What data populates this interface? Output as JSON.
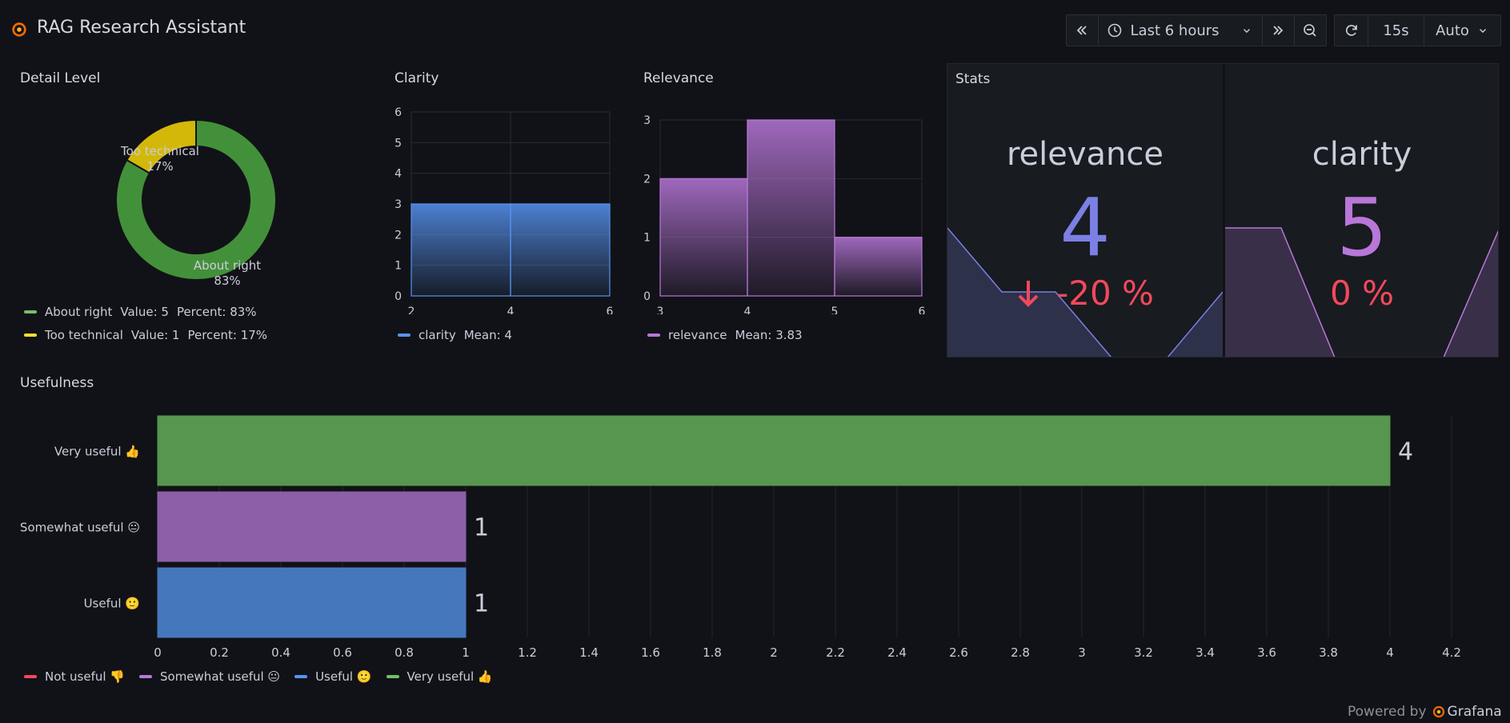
{
  "app": {
    "title": "RAG Research Assistant"
  },
  "toolbar": {
    "back_icon": "chevrons-left-icon",
    "time_range": "Last 6 hours",
    "forward_icon": "chevrons-right-icon",
    "zoom_icon": "zoom-out-icon",
    "refresh_icon": "refresh-icon",
    "refresh_interval": "15s",
    "auto_label": "Auto"
  },
  "panels": {
    "detail_level": {
      "title": "Detail Level",
      "legend": [
        {
          "name": "About right",
          "value_text": "Value: 5",
          "percent_text": "Percent: 83%",
          "color": "#73bf69"
        },
        {
          "name": "Too technical",
          "value_text": "Value: 1",
          "percent_text": "Percent: 17%",
          "color": "#fade2a"
        }
      ],
      "slice_labels": [
        {
          "name": "About right",
          "pct": "83%"
        },
        {
          "name": "Too technical",
          "pct": "17%"
        }
      ]
    },
    "clarity": {
      "title": "Clarity",
      "legend": {
        "name": "clarity",
        "mean": "Mean: 4",
        "color": "#5794f2"
      }
    },
    "relevance": {
      "title": "Relevance",
      "legend": {
        "name": "relevance",
        "mean": "Mean: 3.83",
        "color": "#b877d9"
      }
    },
    "stats": {
      "title": "Stats",
      "items": [
        {
          "label": "relevance",
          "value": "4",
          "change": "-20 %",
          "color": "#7c7fe4",
          "change_color": "#f2495c"
        },
        {
          "label": "clarity",
          "value": "5",
          "change": "0 %",
          "color": "#b877d9",
          "change_color": "#f2495c"
        }
      ]
    },
    "usefulness": {
      "title": "Usefulness",
      "legend": [
        {
          "name": "Not useful 👎",
          "color": "#f2495c"
        },
        {
          "name": "Somewhat useful 😐",
          "color": "#b877d9"
        },
        {
          "name": "Useful 🙂",
          "color": "#5794f2"
        },
        {
          "name": "Very useful 👍",
          "color": "#73bf69"
        }
      ]
    }
  },
  "chart_data": [
    {
      "type": "pie",
      "title": "Detail Level",
      "categories": [
        "About right",
        "Too technical"
      ],
      "values": [
        5,
        1
      ],
      "colors": [
        "#43903a",
        "#d3b80a"
      ]
    },
    {
      "type": "bar",
      "title": "Clarity",
      "bins": [
        [
          2,
          4
        ],
        [
          4,
          6
        ]
      ],
      "values": [
        3,
        3
      ],
      "xticks": [
        "2",
        "4",
        "6"
      ],
      "yticks": [
        "0",
        "1",
        "2",
        "3",
        "4",
        "5",
        "6"
      ],
      "ylim": [
        0,
        6
      ],
      "xlim": [
        2,
        6
      ]
    },
    {
      "type": "bar",
      "title": "Relevance",
      "bins": [
        [
          3,
          4
        ],
        [
          4,
          5
        ],
        [
          5,
          6
        ]
      ],
      "values": [
        2,
        3,
        1
      ],
      "xticks": [
        "3",
        "4",
        "5",
        "6"
      ],
      "yticks": [
        "0",
        "1",
        "2",
        "3"
      ],
      "ylim": [
        0,
        3
      ],
      "xlim": [
        3,
        6
      ]
    },
    {
      "type": "bar",
      "title": "Usefulness",
      "orientation": "horizontal",
      "categories": [
        "Very useful 👍",
        "Somewhat useful 😐",
        "Useful 🙂"
      ],
      "values": [
        4,
        1,
        1
      ],
      "value_labels": [
        "4",
        "1",
        "1"
      ],
      "colors": [
        "#56964f",
        "#8c5fa8",
        "#4577bd"
      ],
      "xticks": [
        "0",
        "0.2",
        "0.4",
        "0.6",
        "0.8",
        "1",
        "1.2",
        "1.4",
        "1.6",
        "1.8",
        "2",
        "2.2",
        "2.4",
        "2.6",
        "2.8",
        "3",
        "3.2",
        "3.4",
        "3.6",
        "3.8",
        "4",
        "4.2"
      ],
      "xlim": [
        0,
        4.2
      ]
    }
  ],
  "footer": {
    "powered_by": "Powered by",
    "brand": "Grafana"
  }
}
